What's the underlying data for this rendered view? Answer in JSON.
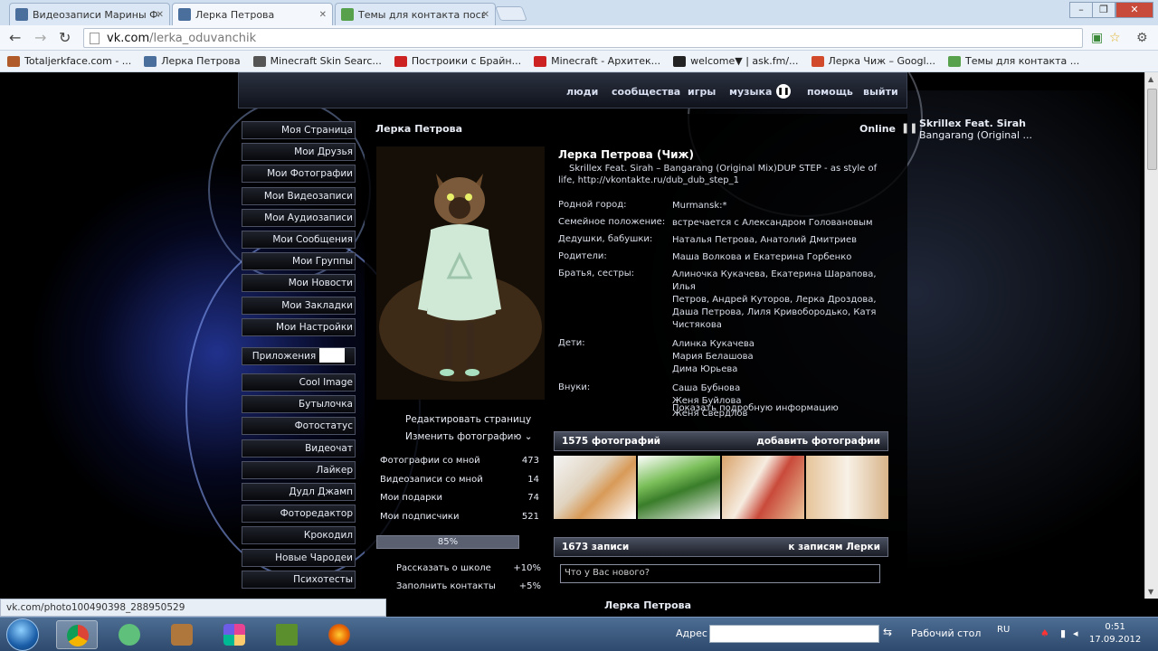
{
  "browser": {
    "tabs": [
      {
        "label": "Видеозаписи Марины Фе",
        "color": "#4a6f9c",
        "active": false
      },
      {
        "label": "Лерка Петрова",
        "color": "#4a6f9c",
        "active": true
      },
      {
        "label": "Темы для контакта посв",
        "color": "#57a04c",
        "active": false
      }
    ],
    "url_domain": "vk.com",
    "url_path": "/lerka_oduvanchik",
    "bookmarks": [
      {
        "label": "Totaljerkface.com - ...",
        "color": "#b05a2a"
      },
      {
        "label": "Лерка Петрова",
        "color": "#4a6f9c"
      },
      {
        "label": "Minecraft Skin Searc...",
        "color": "#555555"
      },
      {
        "label": "Построики с Брайн...",
        "color": "#cc2222"
      },
      {
        "label": "Minecraft - Архитек...",
        "color": "#cc2222"
      },
      {
        "label": "welcome▼ | ask.fm/...",
        "color": "#222222"
      },
      {
        "label": "Лерка Чиж – Googl...",
        "color": "#d24a2c"
      },
      {
        "label": "Темы для контакта ...",
        "color": "#57a04c"
      }
    ]
  },
  "vk": {
    "topnav": [
      "люди",
      "сообщества",
      "игры",
      "музыка",
      "помощь",
      "выйти"
    ],
    "sidebar_main": [
      "Моя Страница",
      "Мои Друзья",
      "Мои Фотографии",
      "Мои Видеозаписи",
      "Мои Аудиозаписи",
      "Мои Сообщения",
      "Мои Группы",
      "Мои Новости",
      "Мои Закладки",
      "Мои Настройки"
    ],
    "apps_label": "Приложения",
    "sidebar_apps": [
      "Cool Image",
      "Бутылочка",
      "Фотостатус",
      "Видеочат",
      "Лайкер",
      "Дудл Джамп",
      "Фоторедактор",
      "Крокодил",
      "Новые Чародеи",
      "Психотесты"
    ],
    "header_name": "Лерка Петрова",
    "online": "Online",
    "player": {
      "artist": "Skrillex Feat. Sirah",
      "track": "Bangarang (Original ..."
    },
    "edit_page": "Редактировать страницу",
    "change_photo": "Изменить фотографию",
    "stats": [
      {
        "label": "Фотографии со мной",
        "value": "473"
      },
      {
        "label": "Видеозаписи со мной",
        "value": "14"
      },
      {
        "label": "Мои подарки",
        "value": "74"
      },
      {
        "label": "Мои подписчики",
        "value": "521"
      }
    ],
    "progress": {
      "label": "85%",
      "value": 0.85
    },
    "tasks": [
      {
        "label": "Рассказать о школе",
        "value": "+10%"
      },
      {
        "label": "Заполнить контакты",
        "value": "+5%"
      }
    ],
    "profile_name": "Лерка Петрова (Чиж)",
    "status": "Skrillex Feat. Sirah – Bangarang (Original Mix)DUP STEP - as style of life, http://vkontakte.ru/dub_dub_step_1",
    "info": [
      {
        "label": "Родной город:",
        "value": [
          "Murmansk:*"
        ]
      },
      {
        "label": "Семейное положение:",
        "value": [
          "встречается с Александром Головановым"
        ]
      },
      {
        "label": "Дедушки, бабушки:",
        "value": [
          "Наталья Петрова, Анатолий Дмитриев"
        ]
      },
      {
        "label": "Родители:",
        "value": [
          "Маша Волкова и Екатерина Горбенко"
        ]
      },
      {
        "label": "Братья, сестры:",
        "value": [
          "Алиночка Кукачева, Екатерина Шарапова, Илья",
          "Петров, Андрей Куторов, Лерка Дроздова,",
          "Даша Петрова, Лиля Кривобородько, Катя",
          "Чистякова"
        ]
      },
      {
        "label": "Дети:",
        "value": [
          "Алинка Кукачева",
          "Мария Белашова",
          "Дима Юрьева"
        ]
      },
      {
        "label": "Внуки:",
        "value": [
          "Саша Бубнова",
          "Женя Буйлова",
          "Женя Свердлов"
        ]
      }
    ],
    "more_info": "Показать подробную информацию",
    "photos_count": "1575 фотографий",
    "add_photos": "добавить фотографии",
    "posts_count": "1673 записи",
    "to_posts": "к записям Лерки",
    "post_placeholder": "Что у Вас нового?",
    "post_author": "Лерка Петрова"
  },
  "statusbar": "vk.com/photo100490398_288950529",
  "taskbar": {
    "address_label": "Адрес",
    "desktop_label": "Рабочий стол",
    "lang": "RU",
    "time": "0:51",
    "date": "17.09.2012"
  }
}
